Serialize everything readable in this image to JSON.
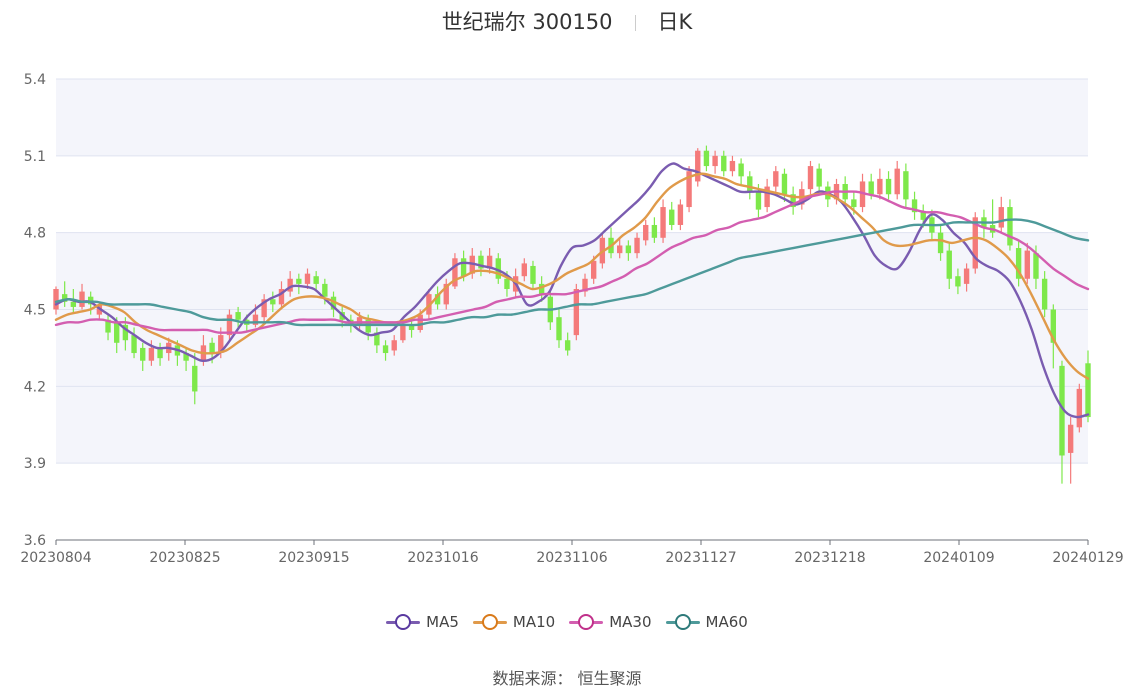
{
  "header": {
    "stock": "世纪瑞尔 300150",
    "period": "日K"
  },
  "source": {
    "label": "数据来源：",
    "name": "恒生聚源"
  },
  "colors": {
    "up": "#f47a7a",
    "down": "#7ee84a",
    "ma5": "#7a5cb0",
    "ma10": "#e09a4a",
    "ma30": "#d35eb0",
    "ma60": "#4e9a9a",
    "band": "#f4f5fb",
    "grid": "#dfe3f0"
  },
  "chart_data": {
    "type": "candlestick",
    "ylim": [
      3.6,
      5.4
    ],
    "yticks": [
      "3.6",
      "3.9",
      "4.2",
      "4.5",
      "4.8",
      "5.1",
      "5.4"
    ],
    "xlabels": [
      "20230804",
      "20230825",
      "20230915",
      "20231016",
      "20231106",
      "20231127",
      "20231218",
      "20240109",
      "20240129"
    ],
    "n": 120,
    "series": [
      {
        "key": "ma5",
        "name": "MA5",
        "values": [
          4.52,
          4.54,
          4.53,
          4.53,
          4.5,
          4.47,
          4.43,
          4.4,
          4.37,
          4.35,
          4.35,
          4.34,
          4.32,
          4.3,
          4.31,
          4.35,
          4.41,
          4.47,
          4.51,
          4.54,
          4.56,
          4.59,
          4.59,
          4.58,
          4.54,
          4.5,
          4.46,
          4.42,
          4.4,
          4.41,
          4.42,
          4.47,
          4.51,
          4.56,
          4.61,
          4.65,
          4.68,
          4.68,
          4.67,
          4.66,
          4.64,
          4.6,
          4.52,
          4.53,
          4.57,
          4.67,
          4.74,
          4.75,
          4.77,
          4.81,
          4.85,
          4.89,
          4.93,
          4.98,
          5.04,
          5.07,
          5.05,
          5.04,
          5.02,
          5.0,
          4.98,
          4.96,
          4.96,
          4.96,
          4.95,
          4.93,
          4.91,
          4.93,
          4.96,
          4.95,
          4.92,
          4.86,
          4.79,
          4.71,
          4.67,
          4.66,
          4.72,
          4.81,
          4.87,
          4.85,
          4.8,
          4.76,
          4.7,
          4.67,
          4.65,
          4.61,
          4.53,
          4.42,
          4.28,
          4.17,
          4.1,
          4.08,
          4.09
        ]
      },
      {
        "key": "ma10",
        "name": "MA10",
        "values": [
          4.46,
          4.48,
          4.49,
          4.5,
          4.52,
          4.51,
          4.49,
          4.45,
          4.42,
          4.4,
          4.38,
          4.36,
          4.34,
          4.33,
          4.33,
          4.34,
          4.37,
          4.4,
          4.43,
          4.47,
          4.51,
          4.54,
          4.55,
          4.55,
          4.54,
          4.52,
          4.5,
          4.47,
          4.46,
          4.45,
          4.45,
          4.46,
          4.48,
          4.52,
          4.57,
          4.61,
          4.63,
          4.65,
          4.65,
          4.64,
          4.62,
          4.6,
          4.58,
          4.59,
          4.61,
          4.64,
          4.66,
          4.68,
          4.72,
          4.75,
          4.79,
          4.82,
          4.86,
          4.92,
          4.97,
          5.0,
          5.02,
          5.03,
          5.02,
          5.01,
          4.99,
          4.98,
          4.97,
          4.96,
          4.95,
          4.94,
          4.94,
          4.95,
          4.95,
          4.93,
          4.9,
          4.86,
          4.82,
          4.77,
          4.75,
          4.75,
          4.76,
          4.77,
          4.77,
          4.76,
          4.77,
          4.78,
          4.77,
          4.74,
          4.7,
          4.64,
          4.56,
          4.47,
          4.38,
          4.31,
          4.26,
          4.23
        ]
      },
      {
        "key": "ma30",
        "name": "MA30",
        "values": [
          4.44,
          4.45,
          4.45,
          4.46,
          4.46,
          4.45,
          4.45,
          4.44,
          4.43,
          4.42,
          4.42,
          4.42,
          4.42,
          4.42,
          4.41,
          4.41,
          4.41,
          4.42,
          4.43,
          4.44,
          4.45,
          4.46,
          4.46,
          4.46,
          4.46,
          4.45,
          4.45,
          4.45,
          4.45,
          4.45,
          4.45,
          4.46,
          4.46,
          4.47,
          4.48,
          4.49,
          4.5,
          4.51,
          4.53,
          4.54,
          4.55,
          4.55,
          4.56,
          4.56,
          4.56,
          4.57,
          4.58,
          4.59,
          4.61,
          4.63,
          4.66,
          4.68,
          4.71,
          4.74,
          4.76,
          4.78,
          4.79,
          4.81,
          4.82,
          4.84,
          4.85,
          4.86,
          4.88,
          4.9,
          4.92,
          4.94,
          4.95,
          4.96,
          4.96,
          4.96,
          4.95,
          4.94,
          4.92,
          4.9,
          4.89,
          4.88,
          4.88,
          4.87,
          4.86,
          4.84,
          4.82,
          4.81,
          4.79,
          4.77,
          4.74,
          4.7,
          4.66,
          4.63,
          4.6,
          4.58
        ]
      },
      {
        "key": "ma60",
        "name": "MA60",
        "values": [
          4.53,
          4.54,
          4.53,
          4.53,
          4.52,
          4.52,
          4.52,
          4.52,
          4.51,
          4.5,
          4.49,
          4.47,
          4.46,
          4.46,
          4.45,
          4.45,
          4.45,
          4.45,
          4.44,
          4.44,
          4.44,
          4.44,
          4.44,
          4.44,
          4.44,
          4.44,
          4.44,
          4.44,
          4.45,
          4.45,
          4.46,
          4.47,
          4.47,
          4.48,
          4.48,
          4.49,
          4.5,
          4.5,
          4.51,
          4.52,
          4.52,
          4.53,
          4.54,
          4.55,
          4.56,
          4.58,
          4.6,
          4.62,
          4.64,
          4.66,
          4.68,
          4.7,
          4.71,
          4.72,
          4.73,
          4.74,
          4.75,
          4.76,
          4.77,
          4.78,
          4.79,
          4.8,
          4.81,
          4.82,
          4.83,
          4.83,
          4.83,
          4.84,
          4.84,
          4.84,
          4.84,
          4.85,
          4.85,
          4.84,
          4.82,
          4.8,
          4.78,
          4.77
        ]
      },
      {
        "key": "candles",
        "name": "日K",
        "values": [
          [
            4.5,
            4.58,
            4.59,
            4.48
          ],
          [
            4.56,
            4.53,
            4.61,
            4.51
          ],
          [
            4.53,
            4.51,
            4.58,
            4.49
          ],
          [
            4.51,
            4.57,
            4.6,
            4.5
          ],
          [
            4.55,
            4.52,
            4.57,
            4.48
          ],
          [
            4.48,
            4.52,
            4.53,
            4.46
          ],
          [
            4.46,
            4.41,
            4.48,
            4.38
          ],
          [
            4.45,
            4.37,
            4.47,
            4.33
          ],
          [
            4.44,
            4.38,
            4.47,
            4.34
          ],
          [
            4.4,
            4.33,
            4.43,
            4.31
          ],
          [
            4.35,
            4.3,
            4.37,
            4.26
          ],
          [
            4.3,
            4.35,
            4.38,
            4.28
          ],
          [
            4.35,
            4.31,
            4.37,
            4.28
          ],
          [
            4.33,
            4.37,
            4.39,
            4.3
          ],
          [
            4.36,
            4.32,
            4.38,
            4.28
          ],
          [
            4.33,
            4.3,
            4.35,
            4.26
          ],
          [
            4.28,
            4.18,
            4.33,
            4.13
          ],
          [
            4.3,
            4.36,
            4.4,
            4.28
          ],
          [
            4.37,
            4.33,
            4.39,
            4.29
          ],
          [
            4.33,
            4.4,
            4.43,
            4.31
          ],
          [
            4.4,
            4.48,
            4.5,
            4.38
          ],
          [
            4.49,
            4.46,
            4.51,
            4.43
          ],
          [
            4.46,
            4.44,
            4.48,
            4.41
          ],
          [
            4.44,
            4.48,
            4.52,
            4.43
          ],
          [
            4.47,
            4.54,
            4.56,
            4.45
          ],
          [
            4.54,
            4.52,
            4.57,
            4.49
          ],
          [
            4.52,
            4.58,
            4.61,
            4.5
          ],
          [
            4.57,
            4.62,
            4.65,
            4.55
          ],
          [
            4.62,
            4.6,
            4.64,
            4.56
          ],
          [
            4.6,
            4.64,
            4.66,
            4.58
          ],
          [
            4.63,
            4.6,
            4.65,
            4.57
          ],
          [
            4.6,
            4.55,
            4.62,
            4.52
          ],
          [
            4.55,
            4.5,
            4.57,
            4.47
          ],
          [
            4.49,
            4.46,
            4.51,
            4.43
          ],
          [
            4.46,
            4.44,
            4.48,
            4.41
          ],
          [
            4.44,
            4.47,
            4.49,
            4.42
          ],
          [
            4.46,
            4.41,
            4.48,
            4.38
          ],
          [
            4.41,
            4.36,
            4.43,
            4.33
          ],
          [
            4.36,
            4.33,
            4.38,
            4.3
          ],
          [
            4.34,
            4.38,
            4.4,
            4.32
          ],
          [
            4.38,
            4.44,
            4.46,
            4.37
          ],
          [
            4.44,
            4.42,
            4.47,
            4.39
          ],
          [
            4.42,
            4.48,
            4.5,
            4.41
          ],
          [
            4.48,
            4.56,
            4.58,
            4.46
          ],
          [
            4.56,
            4.52,
            4.59,
            4.5
          ],
          [
            4.52,
            4.6,
            4.62,
            4.5
          ],
          [
            4.59,
            4.7,
            4.72,
            4.58
          ],
          [
            4.7,
            4.63,
            4.73,
            4.61
          ],
          [
            4.64,
            4.71,
            4.74,
            4.62
          ],
          [
            4.71,
            4.66,
            4.73,
            4.63
          ],
          [
            4.66,
            4.71,
            4.74,
            4.64
          ],
          [
            4.7,
            4.62,
            4.72,
            4.6
          ],
          [
            4.62,
            4.58,
            4.65,
            4.55
          ],
          [
            4.57,
            4.63,
            4.66,
            4.55
          ],
          [
            4.63,
            4.68,
            4.7,
            4.61
          ],
          [
            4.67,
            4.6,
            4.69,
            4.58
          ],
          [
            4.6,
            4.56,
            4.63,
            4.53
          ],
          [
            4.55,
            4.45,
            4.58,
            4.42
          ],
          [
            4.47,
            4.38,
            4.5,
            4.35
          ],
          [
            4.38,
            4.34,
            4.41,
            4.32
          ],
          [
            4.4,
            4.58,
            4.6,
            4.38
          ],
          [
            4.57,
            4.62,
            4.64,
            4.55
          ],
          [
            4.62,
            4.69,
            4.71,
            4.6
          ],
          [
            4.68,
            4.78,
            4.8,
            4.66
          ],
          [
            4.78,
            4.72,
            4.82,
            4.7
          ],
          [
            4.72,
            4.75,
            4.78,
            4.7
          ],
          [
            4.75,
            4.72,
            4.77,
            4.69
          ],
          [
            4.72,
            4.78,
            4.8,
            4.7
          ],
          [
            4.77,
            4.83,
            4.85,
            4.75
          ],
          [
            4.83,
            4.78,
            4.86,
            4.76
          ],
          [
            4.78,
            4.9,
            4.93,
            4.76
          ],
          [
            4.89,
            4.83,
            4.92,
            4.81
          ],
          [
            4.83,
            4.91,
            4.93,
            4.81
          ],
          [
            4.9,
            5.04,
            5.06,
            4.88
          ],
          [
            5.0,
            5.12,
            5.13,
            4.98
          ],
          [
            5.12,
            5.06,
            5.14,
            5.04
          ],
          [
            5.06,
            5.1,
            5.12,
            5.03
          ],
          [
            5.1,
            5.04,
            5.12,
            5.02
          ],
          [
            5.04,
            5.08,
            5.1,
            5.02
          ],
          [
            5.07,
            5.02,
            5.09,
            4.99
          ],
          [
            5.02,
            4.96,
            5.04,
            4.93
          ],
          [
            4.96,
            4.89,
            4.99,
            4.86
          ],
          [
            4.9,
            4.98,
            5.01,
            4.88
          ],
          [
            4.98,
            5.04,
            5.06,
            4.96
          ],
          [
            5.03,
            4.95,
            5.05,
            4.92
          ],
          [
            4.95,
            4.9,
            4.98,
            4.87
          ],
          [
            4.91,
            4.97,
            5.0,
            4.89
          ],
          [
            4.97,
            5.06,
            5.08,
            4.95
          ],
          [
            5.05,
            4.98,
            5.07,
            4.96
          ],
          [
            4.98,
            4.93,
            5.0,
            4.9
          ],
          [
            4.93,
            4.99,
            5.01,
            4.91
          ],
          [
            4.99,
            4.93,
            5.02,
            4.91
          ],
          [
            4.93,
            4.9,
            4.96,
            4.87
          ],
          [
            4.9,
            5.0,
            5.03,
            4.88
          ],
          [
            5.0,
            4.95,
            5.03,
            4.93
          ],
          [
            4.95,
            5.01,
            5.05,
            4.93
          ],
          [
            5.01,
            4.95,
            5.04,
            4.93
          ],
          [
            4.95,
            5.05,
            5.08,
            4.93
          ],
          [
            5.04,
            4.93,
            5.07,
            4.9
          ],
          [
            4.93,
            4.88,
            4.96,
            4.85
          ],
          [
            4.88,
            4.85,
            4.91,
            4.82
          ],
          [
            4.86,
            4.8,
            4.89,
            4.77
          ],
          [
            4.8,
            4.72,
            4.83,
            4.69
          ],
          [
            4.73,
            4.62,
            4.76,
            4.58
          ],
          [
            4.63,
            4.59,
            4.66,
            4.56
          ],
          [
            4.6,
            4.66,
            4.68,
            4.57
          ],
          [
            4.66,
            4.86,
            4.88,
            4.64
          ],
          [
            4.86,
            4.82,
            4.89,
            4.78
          ],
          [
            4.83,
            4.8,
            4.93,
            4.78
          ],
          [
            4.82,
            4.9,
            4.94,
            4.8
          ],
          [
            4.9,
            4.75,
            4.93,
            4.73
          ],
          [
            4.74,
            4.62,
            4.77,
            4.59
          ],
          [
            4.62,
            4.73,
            4.76,
            4.6
          ],
          [
            4.72,
            4.62,
            4.75,
            4.58
          ],
          [
            4.62,
            4.5,
            4.65,
            4.47
          ],
          [
            4.5,
            4.37,
            4.52,
            4.27
          ],
          [
            4.28,
            3.93,
            4.3,
            3.82
          ],
          [
            3.94,
            4.05,
            4.08,
            3.82
          ],
          [
            4.04,
            4.19,
            4.21,
            4.02
          ],
          [
            4.29,
            4.08,
            4.34,
            4.06
          ]
        ]
      }
    ]
  },
  "legend": [
    "MA5",
    "MA10",
    "MA30",
    "MA60"
  ]
}
